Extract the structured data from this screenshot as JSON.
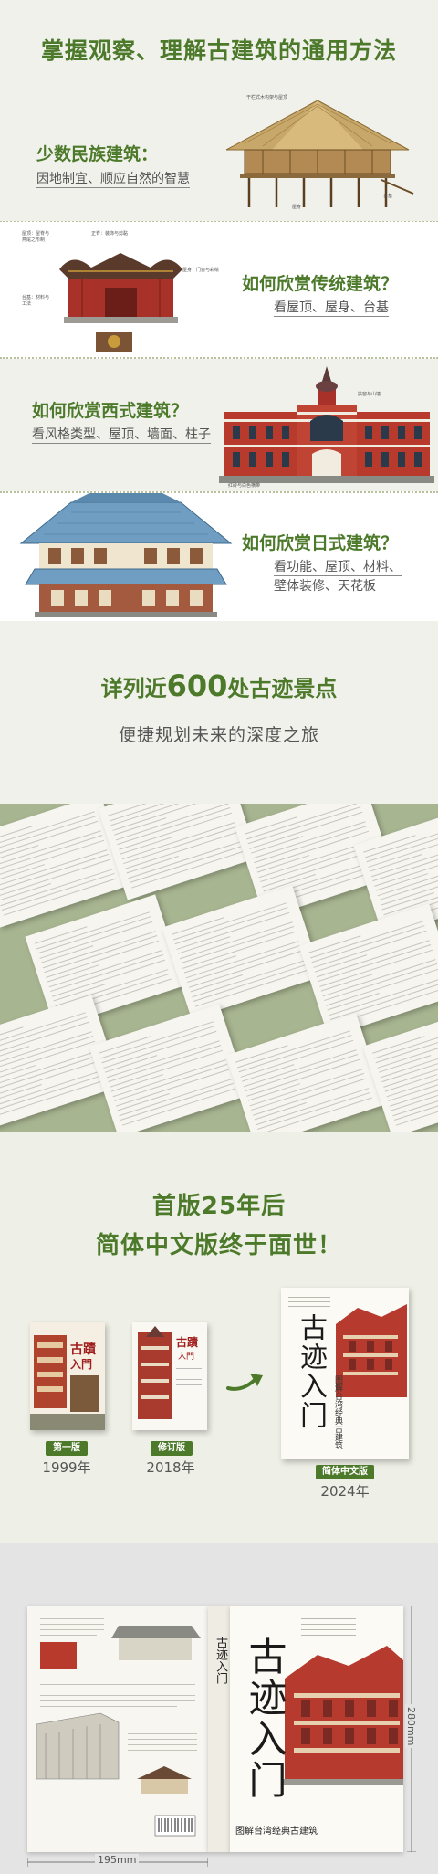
{
  "header": {
    "title": "掌握观察、理解古建筑的通用方法"
  },
  "minority": {
    "heading": "少数民族建筑：",
    "subtitle": "因地制宜、顺应自然的智慧",
    "labels": [
      "干栏式木构架与屋顶",
      "屋身",
      "台基"
    ]
  },
  "traditional": {
    "heading": "如何欣赏传统建筑？",
    "subtitle": "看屋顶、屋身、台基"
  },
  "western": {
    "heading": "如何欣赏西式建筑？",
    "subtitle": "看风格类型、屋顶、墙面、柱子"
  },
  "japanese": {
    "heading": "如何欣赏日式建筑？",
    "subtitle_line1": "看功能、屋顶、材料、",
    "subtitle_line2": "壁体装修、天花板"
  },
  "sites": {
    "prefix": "详列近",
    "count": "600",
    "suffix": "处古迹景点",
    "tagline": "便捷规划未来的深度之旅"
  },
  "editions": {
    "line1": "首版25年后",
    "line2": "简体中文版终于面世！",
    "first": {
      "tag": "第一版",
      "year": "1999年"
    },
    "revised": {
      "tag": "修订版",
      "year": "2018年"
    },
    "simplified": {
      "tag": "简体中文版",
      "year": "2024年"
    },
    "cover_title": "古迹入门",
    "cover_subtitle": "图解台湾经典古建筑"
  },
  "book": {
    "spine_title": "古迹入门",
    "cover_title": "古迹入门",
    "cover_subtitle": "图解台湾经典古建筑",
    "width_label": "195mm",
    "height_label": "280mm"
  },
  "colors": {
    "accent": "#4c7a2a",
    "sage": "#a8b591",
    "brick": "#b83a2c"
  }
}
